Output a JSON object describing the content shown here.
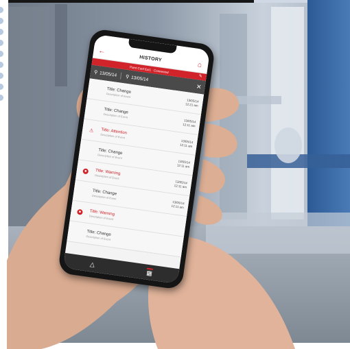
{
  "app": {
    "title": "HISTORY",
    "banner_text": "Point Conf Ext1 · Connected",
    "back_icon": "arrow-left-icon",
    "home_icon": "home-icon",
    "edit_icon": "pencil-icon"
  },
  "filter": {
    "from_date": "13/05/14",
    "to_date": "13/05/14",
    "search_icon": "search-icon",
    "close_icon": "close-icon"
  },
  "events": [
    {
      "title": "Title: Change",
      "desc": "Description of Event",
      "date": "13/05/14",
      "time": "12:21 am",
      "kind": "change",
      "icon": ""
    },
    {
      "title": "Title: Change",
      "desc": "Description of Event",
      "date": "13/05/14",
      "time": "12:11 am",
      "kind": "change",
      "icon": ""
    },
    {
      "title": "Title: Attention",
      "desc": "Description of Event",
      "date": "13/05/14",
      "time": "12:11 am",
      "kind": "attention",
      "icon": "warning-triangle-icon"
    },
    {
      "title": "Title: Change",
      "desc": "Description of Event",
      "date": "13/05/14",
      "time": "12:11 am",
      "kind": "change",
      "icon": ""
    },
    {
      "title": "Title: Warning",
      "desc": "Description of Event",
      "date": "13/05/14",
      "time": "12:11 am",
      "kind": "warning",
      "icon": "stop-circle-icon"
    },
    {
      "title": "Title: Change",
      "desc": "Description of Event",
      "date": "13/05/14",
      "time": "12:11 am",
      "kind": "change",
      "icon": ""
    },
    {
      "title": "Title: Warning",
      "desc": "Description of Event",
      "date": "",
      "time": "",
      "kind": "warning",
      "icon": "stop-circle-icon"
    },
    {
      "title": "Title: Change",
      "desc": "Description of Event",
      "date": "",
      "time": "",
      "kind": "change",
      "icon": ""
    }
  ],
  "tabs": [
    {
      "icon": "alert-triangle-icon"
    },
    {
      "icon": "grid-icon"
    }
  ],
  "colors": {
    "accent": "#d1232a",
    "filter_bar": "#4a4a4a",
    "tab_bar": "#2d2d2d",
    "background_blue": "#3f6fa8",
    "skin": "#e0b39a"
  }
}
